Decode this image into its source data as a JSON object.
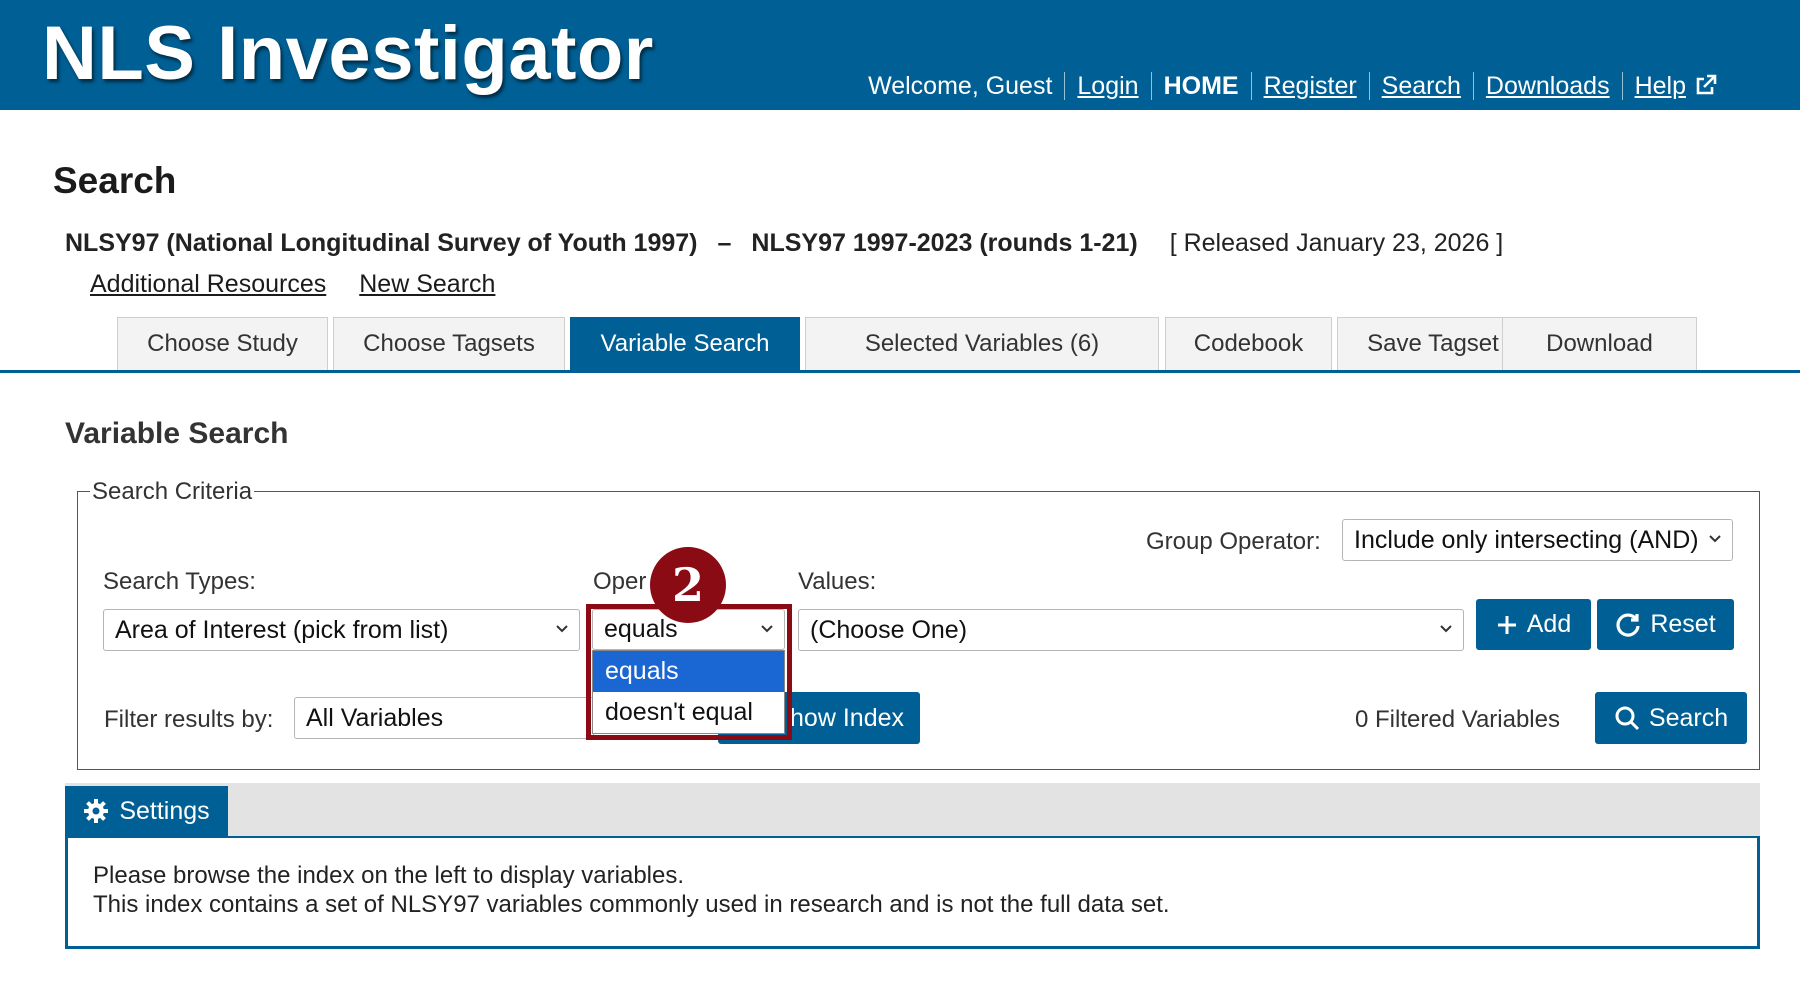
{
  "header": {
    "app_title": "NLS Investigator",
    "welcome": "Welcome, Guest",
    "nav": [
      {
        "label": "Login"
      },
      {
        "label": "HOME"
      },
      {
        "label": "Register"
      },
      {
        "label": "Search"
      },
      {
        "label": "Downloads"
      },
      {
        "label": "Help"
      }
    ],
    "help_icon": "external-link-icon",
    "bg_color": "#005f94"
  },
  "page": {
    "title": "Search",
    "study": "NLSY97 (National Longitudinal Survey of Youth 1997)",
    "separator": "–",
    "rounds": "NLSY97 1997-2023 (rounds 1-21)",
    "release": "[ Released January 23, 2026 ]",
    "links": [
      "Additional Resources",
      "New Search"
    ]
  },
  "tabs": [
    {
      "label": "Choose Study",
      "active": false
    },
    {
      "label": "Choose Tagsets",
      "active": false
    },
    {
      "label": "Variable Search",
      "active": true
    },
    {
      "label": "Selected Variables (6)",
      "active": false
    },
    {
      "label": "Codebook",
      "active": false
    },
    {
      "label": "Save Tagset",
      "active": false
    },
    {
      "label": "Download",
      "active": false
    }
  ],
  "variable_search": {
    "title": "Variable Search",
    "legend": "Search Criteria",
    "group_operator_label": "Group Operator:",
    "group_operator_value": "Include only intersecting (AND)",
    "search_types_label": "Search Types:",
    "search_types_value": "Area of Interest (pick from list)",
    "operator_label": "Oper",
    "operator_value": "equals",
    "operator_options": [
      "equals",
      "doesn't equal"
    ],
    "values_label": "Values:",
    "values_value": "(Choose One)",
    "add_label": "Add",
    "reset_label": "Reset",
    "filter_label": "Filter results by:",
    "filter_value": "All Variables",
    "show_index_label": "how Index",
    "filtered_count": "0 Filtered Variables",
    "search_label": "Search"
  },
  "annotation": {
    "step_number": "2",
    "color": "#8b0b14"
  },
  "settings": {
    "tab_label": "Settings",
    "line1": "Please browse the index on the left to display variables.",
    "line2": "This index contains a set of NLSY97 variables commonly used in research and is not the full data set."
  }
}
